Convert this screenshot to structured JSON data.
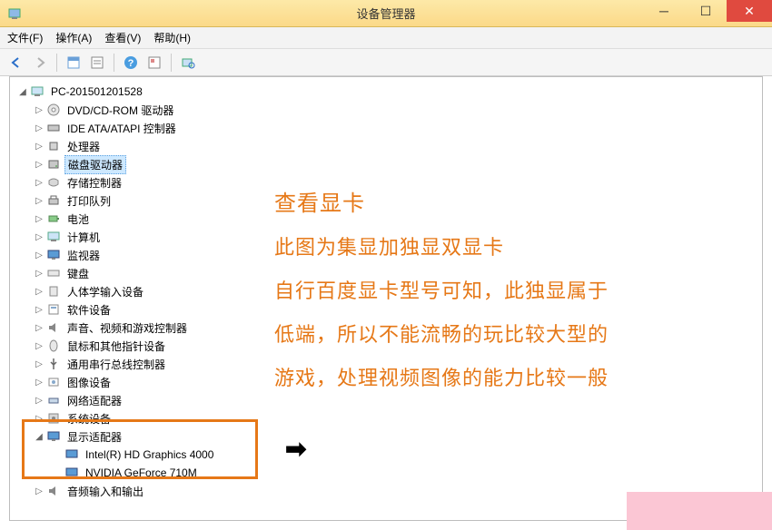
{
  "window": {
    "title": "设备管理器",
    "min_tip": "最小化",
    "max_tip": "最大化",
    "close_tip": "关闭"
  },
  "menu": {
    "file": "文件(F)",
    "action": "操作(A)",
    "view": "查看(V)",
    "help": "帮助(H)"
  },
  "toolbar": {
    "back": "后退",
    "forward": "前进",
    "props": "属性",
    "list": "列表",
    "help": "帮助",
    "refresh": "刷新",
    "scan": "扫描硬件改动"
  },
  "tree": {
    "root": "PC-201501201528",
    "items": [
      {
        "label": "DVD/CD-ROM 驱动器",
        "icon": "disc"
      },
      {
        "label": "IDE ATA/ATAPI 控制器",
        "icon": "ide"
      },
      {
        "label": "处理器",
        "icon": "cpu"
      },
      {
        "label": "磁盘驱动器",
        "icon": "disk",
        "selected": true
      },
      {
        "label": "存储控制器",
        "icon": "storage"
      },
      {
        "label": "打印队列",
        "icon": "printer"
      },
      {
        "label": "电池",
        "icon": "battery"
      },
      {
        "label": "计算机",
        "icon": "computer"
      },
      {
        "label": "监视器",
        "icon": "monitor"
      },
      {
        "label": "键盘",
        "icon": "keyboard"
      },
      {
        "label": "人体学输入设备",
        "icon": "hid"
      },
      {
        "label": "软件设备",
        "icon": "software"
      },
      {
        "label": "声音、视频和游戏控制器",
        "icon": "sound"
      },
      {
        "label": "鼠标和其他指针设备",
        "icon": "mouse"
      },
      {
        "label": "通用串行总线控制器",
        "icon": "usb"
      },
      {
        "label": "图像设备",
        "icon": "image"
      },
      {
        "label": "网络适配器",
        "icon": "network"
      },
      {
        "label": "系统设备",
        "icon": "system"
      }
    ],
    "display_adapter": {
      "label": "显示适配器",
      "children": [
        "Intel(R) HD Graphics 4000",
        "NVIDIA GeForce 710M"
      ]
    },
    "audio": "音频输入和输出"
  },
  "annotation": {
    "title": "查看显卡",
    "line1": "此图为集显加独显双显卡",
    "line2": "自行百度显卡型号可知，此独显属于",
    "line3": "低端，所以不能流畅的玩比较大型的",
    "line4": "游戏，处理视频图像的能力比较一般"
  },
  "colors": {
    "annotation": "#e67817",
    "titlebar_top": "#fde9a8",
    "titlebar_bottom": "#fbd988",
    "close": "#e04a3f"
  }
}
